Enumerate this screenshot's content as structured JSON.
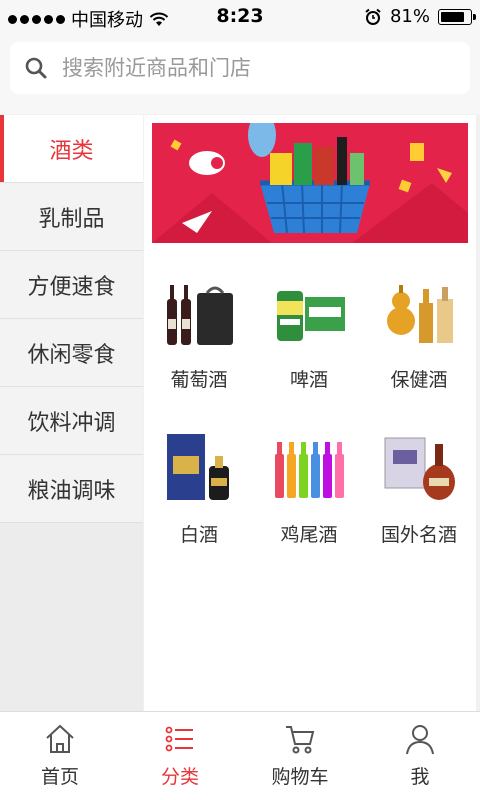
{
  "status_bar": {
    "carrier": "中国移动",
    "time": "8:23",
    "battery": "81%",
    "battery_level": 0.81
  },
  "search": {
    "placeholder": "搜索附近商品和门店"
  },
  "sidebar": {
    "items": [
      {
        "label": "酒类",
        "active": true
      },
      {
        "label": "乳制品"
      },
      {
        "label": "方便速食"
      },
      {
        "label": "休闲零食"
      },
      {
        "label": "饮料冲调"
      },
      {
        "label": "粮油调味"
      }
    ]
  },
  "products": [
    {
      "label": "葡萄酒",
      "icon": "wine-bottles-icon"
    },
    {
      "label": "啤酒",
      "icon": "beer-cans-icon"
    },
    {
      "label": "保健酒",
      "icon": "health-liquor-icon"
    },
    {
      "label": "白酒",
      "icon": "baijiu-box-icon"
    },
    {
      "label": "鸡尾酒",
      "icon": "cocktail-bottles-icon"
    },
    {
      "label": "国外名酒",
      "icon": "foreign-liquor-icon"
    }
  ],
  "tabbar": {
    "items": [
      {
        "label": "首页",
        "icon": "home-icon"
      },
      {
        "label": "分类",
        "icon": "category-list-icon",
        "active": true
      },
      {
        "label": "购物车",
        "icon": "cart-icon"
      },
      {
        "label": "我",
        "icon": "user-icon"
      }
    ]
  },
  "colors": {
    "accent": "#e8353a",
    "banner": "#e3234a"
  }
}
